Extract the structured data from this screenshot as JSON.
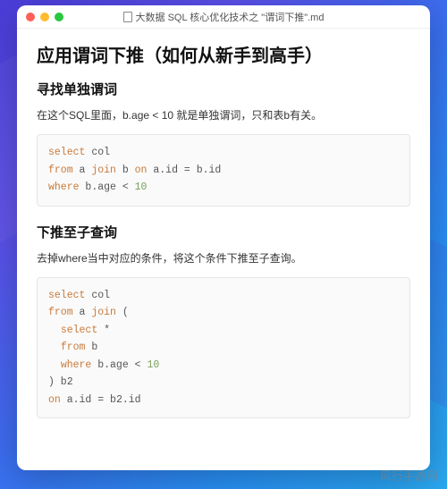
{
  "window": {
    "filename": "大数据 SQL 核心优化技术之 \"谓词下推\".md"
  },
  "doc": {
    "h1": "应用谓词下推（如何从新手到高手）",
    "section1": {
      "heading": "寻找单独谓词",
      "para": "在这个SQL里面，b.age < 10 就是单独谓词，只和表b有关。"
    },
    "section2": {
      "heading": "下推至子查询",
      "para": "去掉where当中对应的条件，将这个条件下推至子查询。"
    }
  },
  "watermark": "风行手游网"
}
